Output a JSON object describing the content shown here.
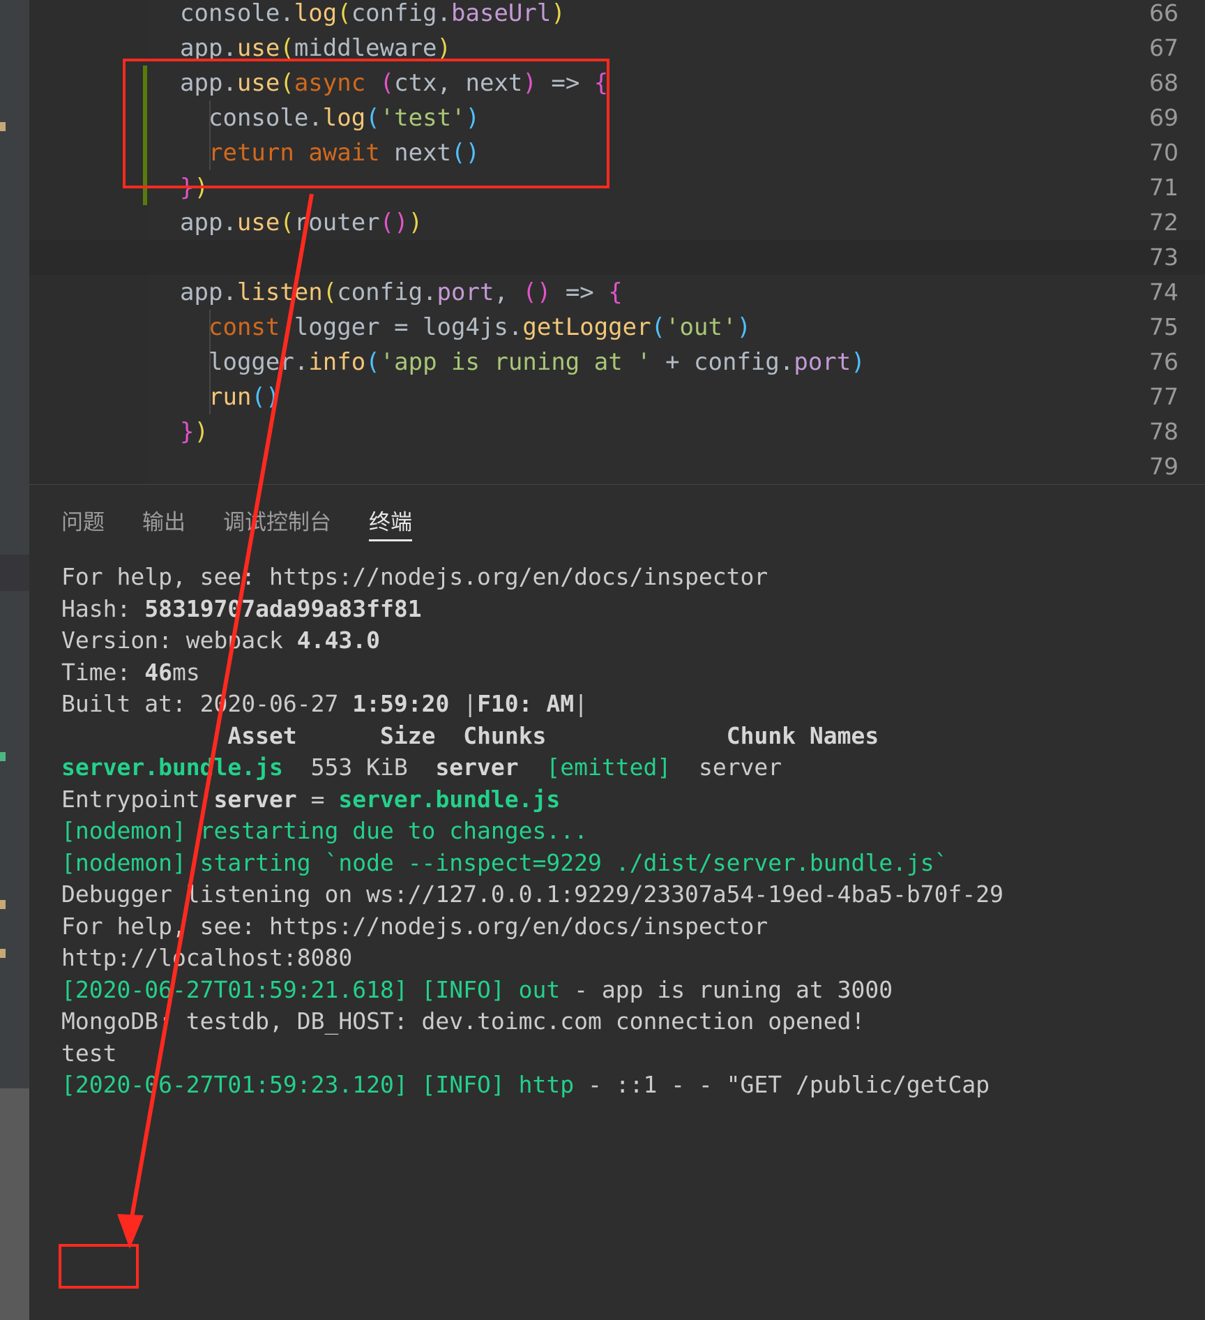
{
  "window": {
    "app": "Visual Studio Code",
    "theme_bg": "#1e1e1e",
    "annotation_color": "#ff2a1f",
    "accent_green": "#23d18b",
    "git_added_color": "#587c0c"
  },
  "editor": {
    "first_visible_line": 66,
    "lines": [
      {
        "num": "66",
        "indent": 0,
        "tokens": [
          {
            "t": "console",
            "c": "t-plain"
          },
          {
            "t": ".",
            "c": "t-punc"
          },
          {
            "t": "log",
            "c": "t-fn"
          },
          {
            "t": "(",
            "c": "t-paren1"
          },
          {
            "t": "config",
            "c": "t-plain"
          },
          {
            "t": ".",
            "c": "t-punc"
          },
          {
            "t": "baseUrl",
            "c": "t-prop"
          },
          {
            "t": ")",
            "c": "t-paren1"
          }
        ]
      },
      {
        "num": "67",
        "indent": 0,
        "tokens": [
          {
            "t": "app",
            "c": "t-plain"
          },
          {
            "t": ".",
            "c": "t-punc"
          },
          {
            "t": "use",
            "c": "t-fn"
          },
          {
            "t": "(",
            "c": "t-paren1"
          },
          {
            "t": "middleware",
            "c": "t-plain"
          },
          {
            "t": ")",
            "c": "t-paren1"
          }
        ]
      },
      {
        "num": "68",
        "indent": 0,
        "git": true,
        "tokens": [
          {
            "t": "app",
            "c": "t-plain"
          },
          {
            "t": ".",
            "c": "t-punc"
          },
          {
            "t": "use",
            "c": "t-fn"
          },
          {
            "t": "(",
            "c": "t-paren1"
          },
          {
            "t": "async",
            "c": "t-kw2"
          },
          {
            "t": " ",
            "c": "t-plain"
          },
          {
            "t": "(",
            "c": "t-paren2"
          },
          {
            "t": "ctx",
            "c": "t-plain"
          },
          {
            "t": ",",
            "c": "t-punc"
          },
          {
            "t": " next",
            "c": "t-plain"
          },
          {
            "t": ")",
            "c": "t-paren2"
          },
          {
            "t": " => ",
            "c": "t-arrow"
          },
          {
            "t": "{",
            "c": "t-paren2"
          }
        ]
      },
      {
        "num": "69",
        "indent": 1,
        "git": true,
        "tokens": [
          {
            "t": "console",
            "c": "t-plain"
          },
          {
            "t": ".",
            "c": "t-punc"
          },
          {
            "t": "log",
            "c": "t-fn"
          },
          {
            "t": "(",
            "c": "t-paren3"
          },
          {
            "t": "'test'",
            "c": "t-str"
          },
          {
            "t": ")",
            "c": "t-paren3"
          }
        ]
      },
      {
        "num": "70",
        "indent": 1,
        "git": true,
        "tokens": [
          {
            "t": "return",
            "c": "t-kw2"
          },
          {
            "t": " ",
            "c": "t-plain"
          },
          {
            "t": "await",
            "c": "t-kw2"
          },
          {
            "t": " next",
            "c": "t-plain"
          },
          {
            "t": "(",
            "c": "t-paren3"
          },
          {
            "t": ")",
            "c": "t-paren3"
          }
        ]
      },
      {
        "num": "71",
        "indent": 0,
        "git": true,
        "tokens": [
          {
            "t": "}",
            "c": "t-paren2"
          },
          {
            "t": ")",
            "c": "t-paren1"
          }
        ]
      },
      {
        "num": "72",
        "indent": 0,
        "tokens": [
          {
            "t": "app",
            "c": "t-plain"
          },
          {
            "t": ".",
            "c": "t-punc"
          },
          {
            "t": "use",
            "c": "t-fn"
          },
          {
            "t": "(",
            "c": "t-paren1"
          },
          {
            "t": "router",
            "c": "t-plain"
          },
          {
            "t": "(",
            "c": "t-paren2"
          },
          {
            "t": ")",
            "c": "t-paren2"
          },
          {
            "t": ")",
            "c": "t-paren1"
          }
        ]
      },
      {
        "num": "73",
        "indent": 0,
        "highlight": true,
        "tokens": []
      },
      {
        "num": "74",
        "indent": 0,
        "tokens": [
          {
            "t": "app",
            "c": "t-plain"
          },
          {
            "t": ".",
            "c": "t-punc"
          },
          {
            "t": "listen",
            "c": "t-fn"
          },
          {
            "t": "(",
            "c": "t-paren1"
          },
          {
            "t": "config",
            "c": "t-plain"
          },
          {
            "t": ".",
            "c": "t-punc"
          },
          {
            "t": "port",
            "c": "t-prop"
          },
          {
            "t": ",",
            "c": "t-punc"
          },
          {
            "t": " ",
            "c": "t-plain"
          },
          {
            "t": "(",
            "c": "t-paren2"
          },
          {
            "t": ")",
            "c": "t-paren2"
          },
          {
            "t": " => ",
            "c": "t-arrow"
          },
          {
            "t": "{",
            "c": "t-paren2"
          }
        ]
      },
      {
        "num": "75",
        "indent": 1,
        "tokens": [
          {
            "t": "const",
            "c": "t-kw2"
          },
          {
            "t": " logger = log4js",
            "c": "t-plain"
          },
          {
            "t": ".",
            "c": "t-punc"
          },
          {
            "t": "getLogger",
            "c": "t-fn"
          },
          {
            "t": "(",
            "c": "t-paren3"
          },
          {
            "t": "'out'",
            "c": "t-str"
          },
          {
            "t": ")",
            "c": "t-paren3"
          }
        ]
      },
      {
        "num": "76",
        "indent": 1,
        "tokens": [
          {
            "t": "logger",
            "c": "t-plain"
          },
          {
            "t": ".",
            "c": "t-punc"
          },
          {
            "t": "info",
            "c": "t-fn"
          },
          {
            "t": "(",
            "c": "t-paren3"
          },
          {
            "t": "'app is runing at '",
            "c": "t-str"
          },
          {
            "t": " + ",
            "c": "t-plain"
          },
          {
            "t": "config",
            "c": "t-plain"
          },
          {
            "t": ".",
            "c": "t-punc"
          },
          {
            "t": "port",
            "c": "t-prop"
          },
          {
            "t": ")",
            "c": "t-paren3"
          }
        ]
      },
      {
        "num": "77",
        "indent": 1,
        "tokens": [
          {
            "t": "run",
            "c": "t-fn"
          },
          {
            "t": "(",
            "c": "t-paren3"
          },
          {
            "t": ")",
            "c": "t-paren3"
          }
        ]
      },
      {
        "num": "78",
        "indent": 0,
        "tokens": [
          {
            "t": "}",
            "c": "t-paren2"
          },
          {
            "t": ")",
            "c": "t-paren1"
          }
        ]
      },
      {
        "num": "79",
        "indent": 0,
        "tokens": []
      }
    ]
  },
  "panel": {
    "tabs": [
      {
        "label": "问题",
        "active": false
      },
      {
        "label": "输出",
        "active": false
      },
      {
        "label": "调试控制台",
        "active": false
      },
      {
        "label": "终端",
        "active": true
      }
    ],
    "terminal_lines": [
      {
        "segs": [
          {
            "t": "For help, see: https://nodejs.org/en/docs/inspector",
            "c": "w"
          }
        ]
      },
      {
        "segs": [
          {
            "t": "Hash: ",
            "c": "w"
          },
          {
            "t": "58319707ada99a83ff81",
            "c": "b"
          }
        ]
      },
      {
        "segs": [
          {
            "t": "Version: webpack ",
            "c": "w"
          },
          {
            "t": "4.43.0",
            "c": "b"
          }
        ]
      },
      {
        "segs": [
          {
            "t": "Time: ",
            "c": "w"
          },
          {
            "t": "46",
            "c": "b"
          },
          {
            "t": "ms",
            "c": "w"
          }
        ]
      },
      {
        "segs": [
          {
            "t": "Built at: ",
            "c": "w"
          },
          {
            "t": "2020-06-27 ",
            "c": "w"
          },
          {
            "t": "1:59:20 ",
            "c": "b"
          },
          {
            "t": "|",
            "c": "w"
          },
          {
            "t": "F10: AM",
            "c": "b"
          },
          {
            "t": "|",
            "c": "w"
          }
        ]
      },
      {
        "segs": [
          {
            "t": "            ",
            "c": "w"
          },
          {
            "t": "Asset",
            "c": "b"
          },
          {
            "t": "      ",
            "c": "w"
          },
          {
            "t": "Size",
            "c": "b"
          },
          {
            "t": "  ",
            "c": "w"
          },
          {
            "t": "Chunks",
            "c": "b"
          },
          {
            "t": "             ",
            "c": "w"
          },
          {
            "t": "Chunk Names",
            "c": "b"
          }
        ]
      },
      {
        "segs": [
          {
            "t": "server.bundle.js",
            "c": "bg"
          },
          {
            "t": "  553 KiB  ",
            "c": "w"
          },
          {
            "t": "server",
            "c": "b"
          },
          {
            "t": "  ",
            "c": "w"
          },
          {
            "t": "[emitted]",
            "c": "g"
          },
          {
            "t": "  server",
            "c": "w"
          }
        ]
      },
      {
        "segs": [
          {
            "t": "Entrypoint ",
            "c": "w"
          },
          {
            "t": "server",
            "c": "b"
          },
          {
            "t": " = ",
            "c": "w"
          },
          {
            "t": "server.bundle.js",
            "c": "bg"
          }
        ]
      },
      {
        "segs": [
          {
            "t": "[nodemon] restarting due to changes...",
            "c": "g"
          }
        ]
      },
      {
        "segs": [
          {
            "t": "[nodemon] starting `node --inspect=9229 ./dist/server.bundle.js`",
            "c": "g"
          }
        ]
      },
      {
        "segs": [
          {
            "t": "Debugger listening on ws://127.0.0.1:9229/23307a54-19ed-4ba5-b70f-29",
            "c": "w"
          }
        ]
      },
      {
        "segs": [
          {
            "t": "For help, see: https://nodejs.org/en/docs/inspector",
            "c": "w"
          }
        ]
      },
      {
        "segs": [
          {
            "t": "http://localhost:8080",
            "c": "w"
          }
        ]
      },
      {
        "segs": [
          {
            "t": "[2020-06-27T01:59:21.618] [INFO] out",
            "c": "g"
          },
          {
            "t": " - app is runing at 3000",
            "c": "w"
          }
        ]
      },
      {
        "segs": [
          {
            "t": "MongoDB: testdb, DB_HOST: dev.toimc.com connection opened!",
            "c": "w"
          }
        ]
      },
      {
        "segs": [
          {
            "t": "test",
            "c": "w"
          }
        ]
      },
      {
        "segs": [
          {
            "t": "[2020-06-27T01:59:23.120] [INFO] http",
            "c": "g"
          },
          {
            "t": " - ::1 - - \"GET /public/getCap",
            "c": "w"
          }
        ]
      }
    ]
  },
  "annotations": {
    "code_box_label": "highlight-box-middleware",
    "output_box_label": "highlight-box-test-output",
    "arrow_label": "pointer-arrow"
  }
}
